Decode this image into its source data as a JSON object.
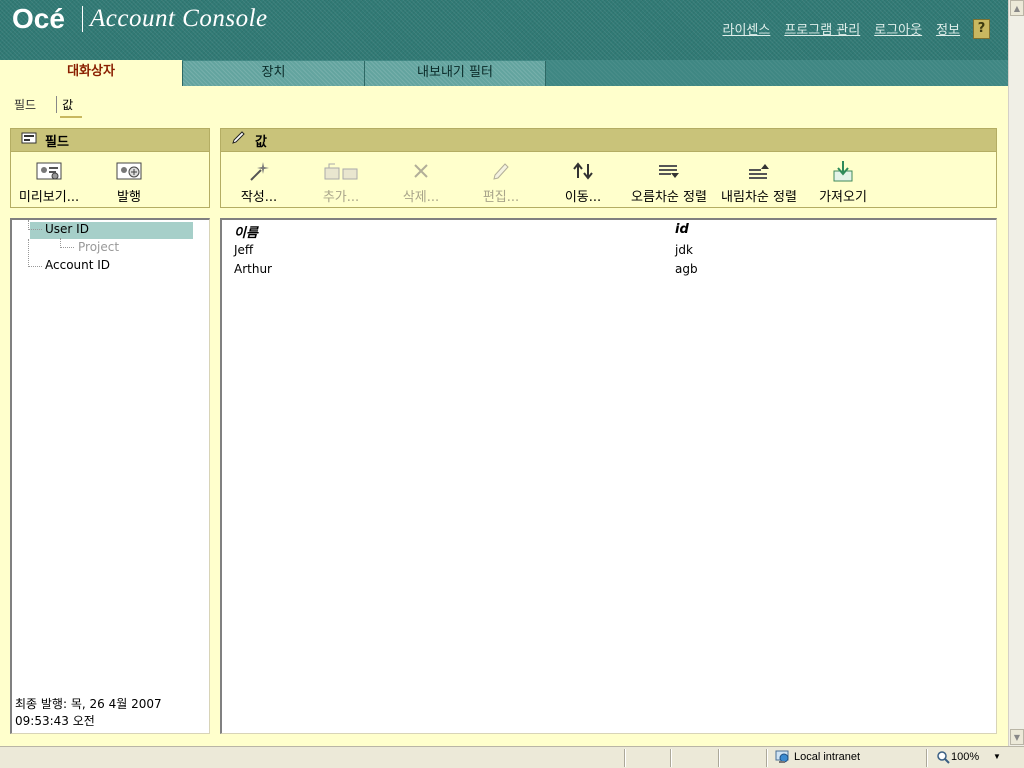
{
  "header": {
    "brand": "Océ",
    "product": "Account Console",
    "links": [
      "라이센스",
      "프로그램 관리",
      "로그아웃",
      "정보"
    ],
    "help_label": "?"
  },
  "tabs": [
    "대화상자",
    "장치",
    "내보내기 필터"
  ],
  "subtabs": [
    "필드",
    "값"
  ],
  "field_panel": {
    "title": "필드",
    "tools": [
      {
        "label": "미리보기...",
        "icon": "preview-icon"
      },
      {
        "label": "발행",
        "icon": "publish-icon"
      }
    ]
  },
  "value_panel": {
    "title": "값",
    "tools": [
      {
        "label": "작성...",
        "icon": "sparkle-icon",
        "enabled": true
      },
      {
        "label": "추가...",
        "icon": "add-folder-icon",
        "enabled": false
      },
      {
        "label": "삭제...",
        "icon": "delete-x-icon",
        "enabled": false
      },
      {
        "label": "편집...",
        "icon": "pencil-icon",
        "enabled": false
      },
      {
        "label": "이동...",
        "icon": "move-arrows-icon",
        "enabled": true
      },
      {
        "label": "오름차순 정렬",
        "icon": "sort-ascending-icon",
        "enabled": true
      },
      {
        "label": "내림차순 정렬",
        "icon": "sort-descending-icon",
        "enabled": true
      },
      {
        "label": "가져오기",
        "icon": "import-icon",
        "enabled": true
      }
    ]
  },
  "tree": {
    "items": [
      "User ID",
      "Project",
      "Account ID"
    ],
    "selected": "User ID"
  },
  "footnote": {
    "line1": "최종 발행: 목, 26 4월 2007",
    "line2": "09:53:43 오전"
  },
  "grid": {
    "columns": [
      "이름",
      "id"
    ],
    "rows": [
      [
        "Jeff",
        "jdk"
      ],
      [
        "Arthur",
        "agb"
      ]
    ]
  },
  "statusbar": {
    "zone": "Local intranet",
    "zoom": "100%"
  },
  "colors": {
    "header_teal": "#317a75",
    "background": "#ffffcc",
    "panel_header": "#c9c37a",
    "selection": "#a6cfc9",
    "active_tab_text": "#8a1f00"
  }
}
